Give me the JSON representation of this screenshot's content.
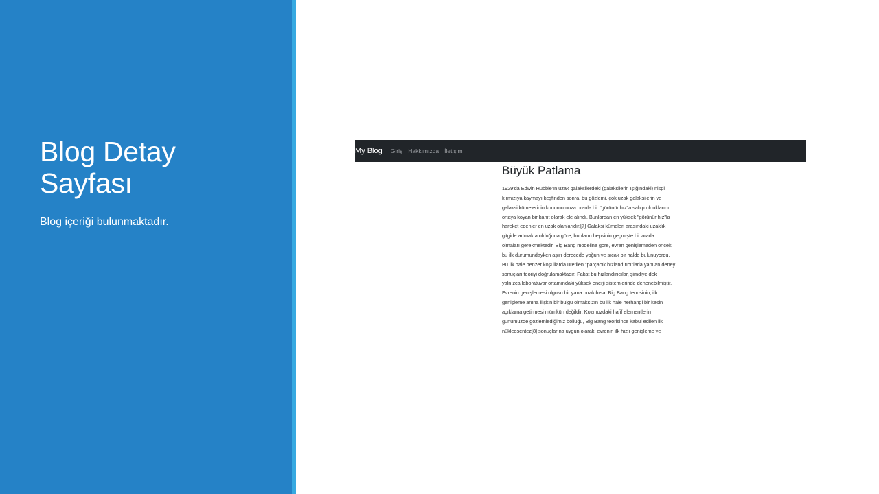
{
  "slide": {
    "title": "Blog Detay Sayfası",
    "subtitle": "Blog içeriği bulunmaktadır."
  },
  "colors": {
    "panel": "#2582c7",
    "accent": "#37a9e1",
    "navbar": "#212529"
  },
  "blog": {
    "brand": "My Blog",
    "nav": [
      {
        "label": "Giriş"
      },
      {
        "label": "Hakkımızda"
      },
      {
        "label": "İletişim"
      }
    ],
    "post": {
      "title": "Büyük Patlama",
      "lines": [
        "1929'da Edwin Hubble'ın uzak galaksilerdeki (galaksilerin ışığındaki) nispi",
        "kırmızıya kaymayı keşfinden sonra, bu gözlemi, çok uzak galaksilerin ve",
        "galaksi kümelerinin konumumuza oranla bir \"görünür hız\"a sahip olduklarını",
        "ortaya koyan bir kanıt olarak ele alındı. Bunlardan en yüksek \"görünür hız\"la",
        "hareket edenler en uzak olanlarıdır.[7] Galaksi kümeleri arasındaki uzaklık",
        "gitgide artmakta olduğuna göre, bunların hepsinin geçmişte bir arada",
        "olmaları gerekmektedir. Big Bang modeline göre, evren genişlemeden önceki",
        "bu ilk durumundayken aşırı derecede yoğun ve sıcak bir halde bulunuyordu.",
        "Bu ilk hale benzer koşullarda üretilen \"parçacık hızlandırıcı\"larla yapılan deney",
        "sonuçları teoriyi doğrulamaktadır. Fakat bu hızlandırıcılar, şimdiye dek",
        "yalnızca laboratuvar ortamındaki yüksek enerji sistemlerinde denenebilmiştir.",
        "Evrenin genişlemesi olgusu bir yana bırakılırsa, Big Bang teorisinin, ilk",
        "genişleme anına ilişkin bir bulgu olmaksızın bu ilk hale herhangi bir kesin",
        "açıklama getirmesi mümkün değildir. Kozmozdaki hafif elementlerin",
        "günümüzde gözlemlediğimiz bolluğu, Big Bang teorisince kabul edilen ilk",
        "nükleosentez[8] sonuçlarına uygun olarak, evrenin ilk hızlı genişleme ve"
      ]
    }
  }
}
